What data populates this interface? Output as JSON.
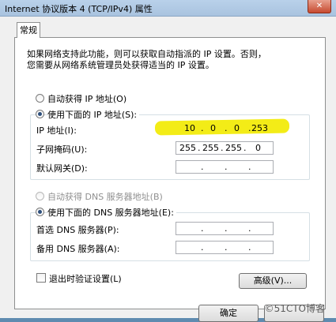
{
  "window": {
    "title": "Internet 协议版本 4 (TCP/IPv4) 属性",
    "close_label": "✕"
  },
  "tabs": [
    {
      "label": "常规"
    }
  ],
  "description": {
    "line1": "如果网络支持此功能，则可以获取自动指派的 IP 设置。否则，",
    "line2": "您需要从网络系统管理员处获得适当的 IP 设置。"
  },
  "ip_section": {
    "auto_label": "自动获得 IP 地址(O)",
    "manual_label": "使用下面的 IP 地址(S):",
    "selected": "manual",
    "ip_label": "IP 地址(I):",
    "ip_value": [
      "10",
      "0",
      "0",
      "253"
    ],
    "subnet_label": "子网掩码(U):",
    "subnet_value": [
      "255",
      "255",
      "255",
      "0"
    ],
    "gateway_label": "默认网关(D):",
    "gateway_value": [
      "",
      "",
      "",
      ""
    ]
  },
  "dns_section": {
    "auto_label": "自动获得 DNS 服务器地址(B)",
    "manual_label": "使用下面的 DNS 服务器地址(E):",
    "selected": "manual",
    "preferred_label": "首选 DNS 服务器(P):",
    "preferred_value": [
      "",
      "",
      "",
      ""
    ],
    "alternate_label": "备用 DNS 服务器(A):",
    "alternate_value": [
      "",
      "",
      "",
      ""
    ]
  },
  "validate": {
    "label": "退出时验证设置(L)",
    "checked": false
  },
  "buttons": {
    "advanced": "高级(V)...",
    "ok": "确定",
    "cancel": "取消"
  },
  "watermark": "©51CTO博客",
  "colors": {
    "highlight": "#f3ec17",
    "titlebar": "#b9d1ea"
  }
}
